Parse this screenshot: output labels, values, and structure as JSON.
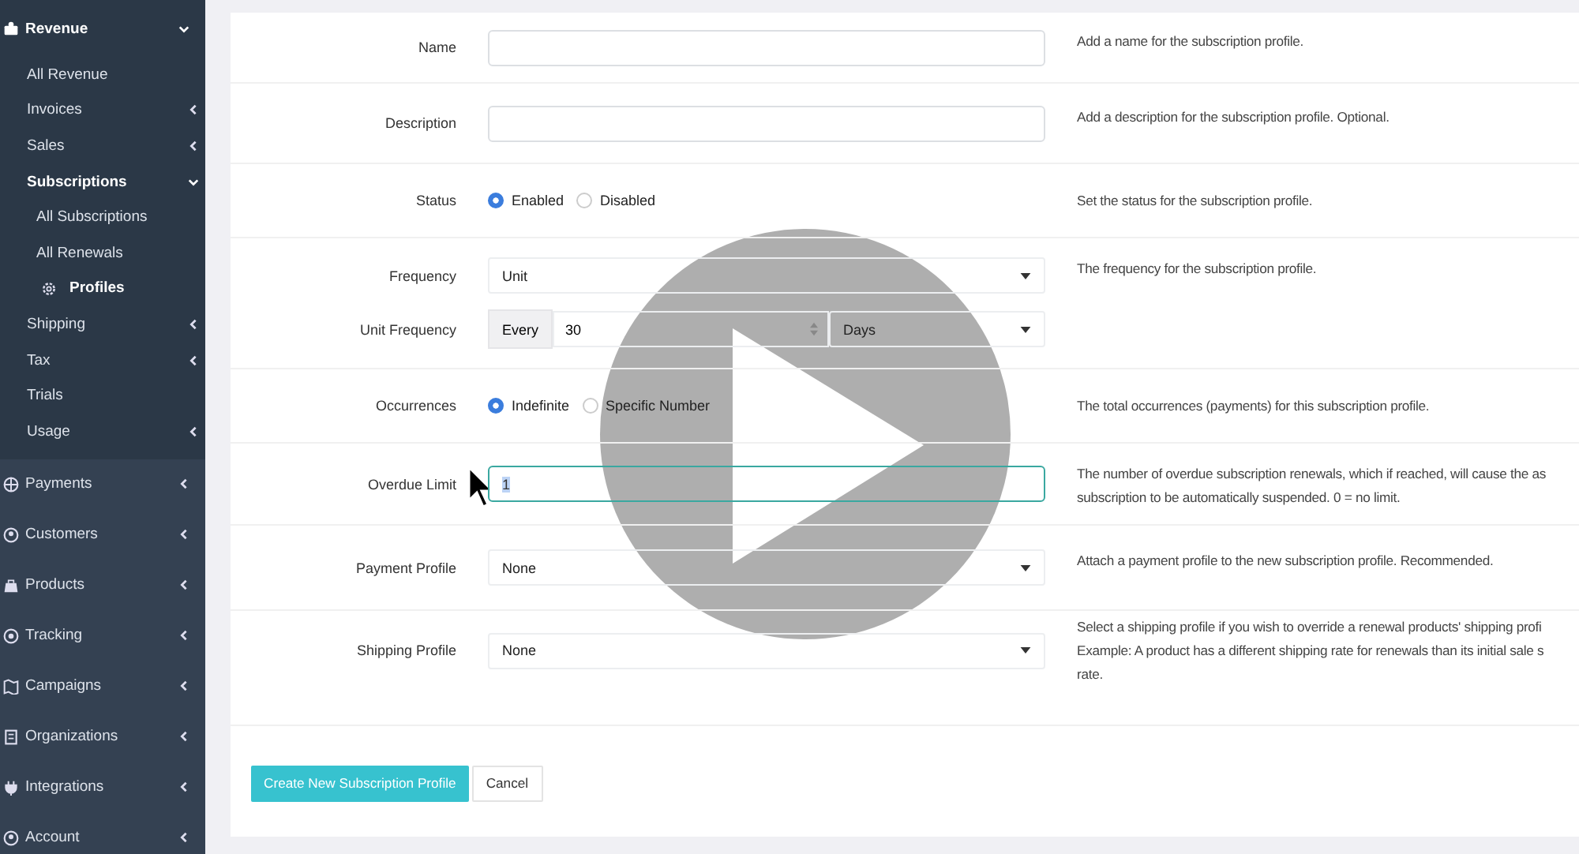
{
  "sidebar": {
    "items": [
      {
        "label": "Revenue",
        "expanded": true,
        "children": [
          {
            "label": "All Revenue",
            "has_submenu": false,
            "expanded": false
          },
          {
            "label": "Invoices",
            "has_submenu": true,
            "expanded": false
          },
          {
            "label": "Sales",
            "has_submenu": true,
            "expanded": false
          },
          {
            "label": "Subscriptions",
            "has_submenu": true,
            "expanded": true,
            "children": [
              {
                "label": "All Subscriptions",
                "selected": false
              },
              {
                "label": "All Renewals",
                "selected": false
              },
              {
                "label": "Profiles",
                "selected": true
              }
            ]
          },
          {
            "label": "Shipping",
            "has_submenu": true,
            "expanded": false
          },
          {
            "label": "Tax",
            "has_submenu": true,
            "expanded": false
          },
          {
            "label": "Trials",
            "has_submenu": false,
            "expanded": false
          },
          {
            "label": "Usage",
            "has_submenu": true,
            "expanded": false
          }
        ]
      },
      {
        "label": "Payments",
        "expanded": false
      },
      {
        "label": "Customers",
        "expanded": false
      },
      {
        "label": "Products",
        "expanded": false
      },
      {
        "label": "Tracking",
        "expanded": false
      },
      {
        "label": "Campaigns",
        "expanded": false
      },
      {
        "label": "Organizations",
        "expanded": false
      },
      {
        "label": "Integrations",
        "expanded": false
      },
      {
        "label": "Account",
        "expanded": false
      }
    ]
  },
  "form": {
    "rows": [
      {
        "label": "Name",
        "kind": "text",
        "value": "",
        "help": [
          "Add a name for the subscription profile."
        ]
      },
      {
        "label": "Description",
        "kind": "text",
        "value": "",
        "help": [
          "Add a description for the subscription profile. Optional."
        ]
      },
      {
        "label": "Status",
        "kind": "radio",
        "options": [
          {
            "label": "Enabled",
            "selected": true
          },
          {
            "label": "Disabled",
            "selected": false
          }
        ],
        "help": [
          "Set the status for the subscription profile."
        ]
      },
      {
        "label": "Frequency",
        "kind": "select",
        "value": "Unit",
        "help": [
          "The frequency for the subscription profile."
        ],
        "sub": {
          "label": "Unit Frequency",
          "addon": "Every",
          "number": "30",
          "unit": "Days"
        }
      },
      {
        "label": "Occurrences",
        "kind": "radio",
        "options": [
          {
            "label": "Indefinite",
            "selected": true
          },
          {
            "label": "Specific Number",
            "selected": false
          }
        ],
        "help": [
          "The total occurrences (payments) for this subscription profile."
        ]
      },
      {
        "label": "Overdue Limit",
        "kind": "text",
        "value": "1",
        "focused": true,
        "help": [
          "The number of overdue subscription renewals, which if reached, will cause the as",
          "subscription to be automatically suspended. 0 = no limit."
        ]
      },
      {
        "label": "Payment Profile",
        "kind": "select",
        "value": "None",
        "help": [
          "Attach a payment profile to the new subscription profile. Recommended."
        ]
      },
      {
        "label": "Shipping Profile",
        "kind": "select",
        "value": "None",
        "help": [
          "Select a shipping profile if you wish to override a renewal products' shipping profi",
          "Example: A product has a different shipping rate for renewals than its initial sale s",
          "rate."
        ]
      }
    ],
    "buttons": [
      {
        "label": "Create New Subscription Profile",
        "kind": "primary"
      },
      {
        "label": "Cancel",
        "kind": "default"
      }
    ]
  }
}
